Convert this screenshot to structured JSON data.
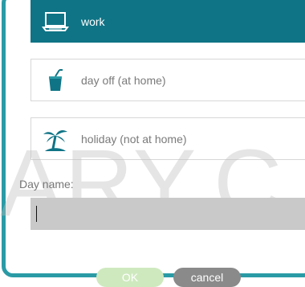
{
  "options": [
    {
      "label": "work",
      "icon": "laptop-icon",
      "selected": true
    },
    {
      "label": "day off (at home)",
      "icon": "drink-cup-icon",
      "selected": false
    },
    {
      "label": "holiday (not at home)",
      "icon": "palm-tree-icon",
      "selected": false
    }
  ],
  "form": {
    "day_name_label": "Day name:",
    "day_name_value": ""
  },
  "buttons": {
    "ok": "OK",
    "cancel": "cancel"
  },
  "watermark": "ARY.C",
  "colors": {
    "frame": "#2a9ba6",
    "selected_bg": "#0f7486",
    "input_bg": "#c9c9c9",
    "ok_bg": "#cfe9bf",
    "cancel_bg": "#8a8a8a",
    "icon_teal": "#0f7486"
  }
}
